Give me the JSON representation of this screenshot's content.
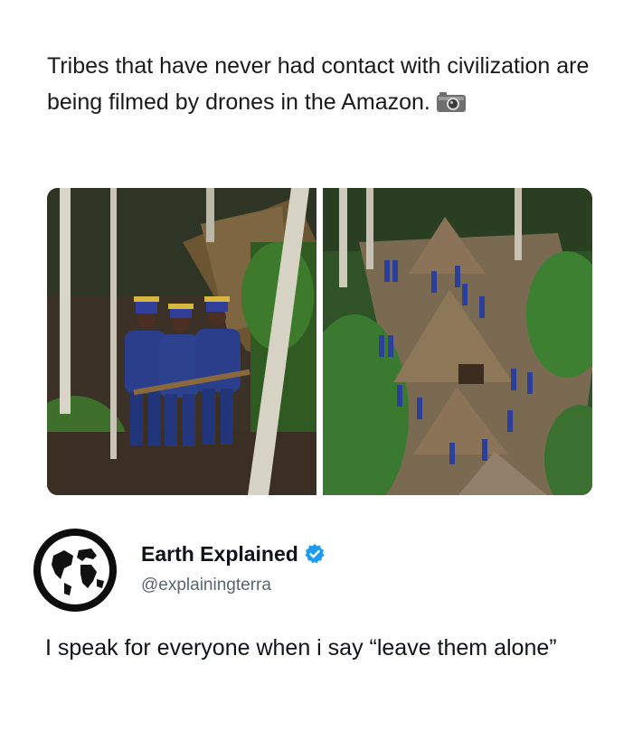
{
  "post": {
    "caption": "Tribes that have never had contact with civilization are being filmed by drones in the Amazon.",
    "caption_icon": "camera-icon"
  },
  "media": {
    "image_left": "three men in blue outfits and feathered headdresses standing in a forest holding a wooden pole",
    "image_right": "aerial view of thatched huts in a forest clearing with people in blue walking among them"
  },
  "tweet": {
    "user_name": "Earth Explained",
    "user_handle": "@explainingterra",
    "verified": true,
    "verified_color": "#1d9bf0",
    "avatar_icon": "globe-icon",
    "text": "I speak for everyone when i say “leave them alone”"
  }
}
